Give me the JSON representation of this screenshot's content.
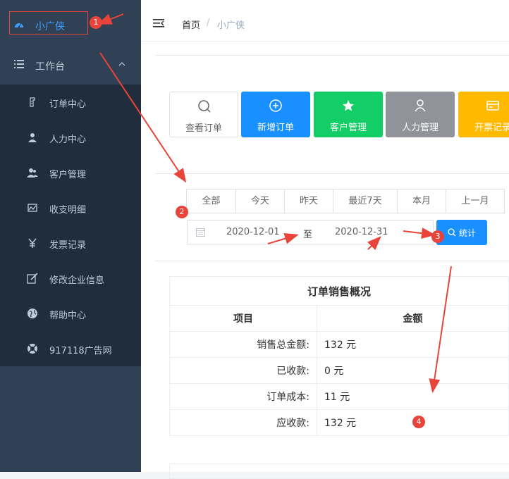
{
  "sidebar": {
    "brand": {
      "label": "小广侠",
      "icon": "dashboard-icon"
    },
    "group": {
      "label": "工作台",
      "icon": "list-icon",
      "chevron": "chevron-up-icon"
    },
    "items": [
      {
        "label": "订单中心",
        "icon": "order-icon"
      },
      {
        "label": "人力中心",
        "icon": "user-icon"
      },
      {
        "label": "客户管理",
        "icon": "peoples-icon"
      },
      {
        "label": "收支明细",
        "icon": "chart-icon"
      },
      {
        "label": "发票记录",
        "icon": "yen-icon"
      },
      {
        "label": "修改企业信息",
        "icon": "edit-icon"
      },
      {
        "label": "帮助中心",
        "icon": "globe-icon"
      },
      {
        "label": "917118广告网",
        "icon": "lifebuoy-icon"
      }
    ]
  },
  "navbar": {
    "breadcrumb": {
      "home": "首页",
      "separator": "/",
      "current": "小广侠"
    }
  },
  "quick_actions": [
    {
      "label": "查看订单",
      "icon": "search-icon",
      "color": "#ffffff"
    },
    {
      "label": "新增订单",
      "icon": "plus-circle-icon",
      "color": "#1890ff"
    },
    {
      "label": "客户管理",
      "icon": "star-icon",
      "color": "#13ce66"
    },
    {
      "label": "人力管理",
      "icon": "user-icon",
      "color": "#909399"
    },
    {
      "label": "开票记录",
      "icon": "card-icon",
      "color": "#ffba00"
    }
  ],
  "filters": [
    "全部",
    "今天",
    "昨天",
    "最近7天",
    "本月",
    "上一月"
  ],
  "date_range": {
    "start": "2020-12-01",
    "separator": "至",
    "end": "2020-12-31"
  },
  "stat_button": {
    "label": "统计",
    "icon": "search-icon"
  },
  "summary": {
    "title": "订单销售概况",
    "headers": [
      "项目",
      "金额"
    ],
    "rows": [
      {
        "label": "销售总金额:",
        "value": "132 元"
      },
      {
        "label": "已收款:",
        "value": "0 元"
      },
      {
        "label": "订单成本:",
        "value": "11 元"
      },
      {
        "label": "应收款:",
        "value": "132 元"
      }
    ]
  },
  "annotations": {
    "markers": [
      "1",
      "2",
      "3",
      "4"
    ],
    "color": "#e8443a"
  }
}
